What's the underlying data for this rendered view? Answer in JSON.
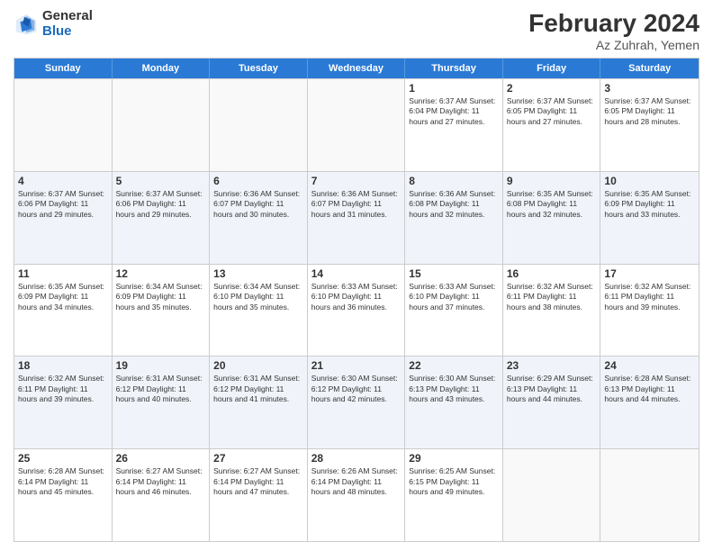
{
  "logo": {
    "general": "General",
    "blue": "Blue"
  },
  "title": "February 2024",
  "subtitle": "Az Zuhrah, Yemen",
  "days_of_week": [
    "Sunday",
    "Monday",
    "Tuesday",
    "Wednesday",
    "Thursday",
    "Friday",
    "Saturday"
  ],
  "weeks": [
    [
      {
        "day": "",
        "info": ""
      },
      {
        "day": "",
        "info": ""
      },
      {
        "day": "",
        "info": ""
      },
      {
        "day": "",
        "info": ""
      },
      {
        "day": "1",
        "info": "Sunrise: 6:37 AM\nSunset: 6:04 PM\nDaylight: 11 hours\nand 27 minutes."
      },
      {
        "day": "2",
        "info": "Sunrise: 6:37 AM\nSunset: 6:05 PM\nDaylight: 11 hours\nand 27 minutes."
      },
      {
        "day": "3",
        "info": "Sunrise: 6:37 AM\nSunset: 6:05 PM\nDaylight: 11 hours\nand 28 minutes."
      }
    ],
    [
      {
        "day": "4",
        "info": "Sunrise: 6:37 AM\nSunset: 6:06 PM\nDaylight: 11 hours\nand 29 minutes."
      },
      {
        "day": "5",
        "info": "Sunrise: 6:37 AM\nSunset: 6:06 PM\nDaylight: 11 hours\nand 29 minutes."
      },
      {
        "day": "6",
        "info": "Sunrise: 6:36 AM\nSunset: 6:07 PM\nDaylight: 11 hours\nand 30 minutes."
      },
      {
        "day": "7",
        "info": "Sunrise: 6:36 AM\nSunset: 6:07 PM\nDaylight: 11 hours\nand 31 minutes."
      },
      {
        "day": "8",
        "info": "Sunrise: 6:36 AM\nSunset: 6:08 PM\nDaylight: 11 hours\nand 32 minutes."
      },
      {
        "day": "9",
        "info": "Sunrise: 6:35 AM\nSunset: 6:08 PM\nDaylight: 11 hours\nand 32 minutes."
      },
      {
        "day": "10",
        "info": "Sunrise: 6:35 AM\nSunset: 6:09 PM\nDaylight: 11 hours\nand 33 minutes."
      }
    ],
    [
      {
        "day": "11",
        "info": "Sunrise: 6:35 AM\nSunset: 6:09 PM\nDaylight: 11 hours\nand 34 minutes."
      },
      {
        "day": "12",
        "info": "Sunrise: 6:34 AM\nSunset: 6:09 PM\nDaylight: 11 hours\nand 35 minutes."
      },
      {
        "day": "13",
        "info": "Sunrise: 6:34 AM\nSunset: 6:10 PM\nDaylight: 11 hours\nand 35 minutes."
      },
      {
        "day": "14",
        "info": "Sunrise: 6:33 AM\nSunset: 6:10 PM\nDaylight: 11 hours\nand 36 minutes."
      },
      {
        "day": "15",
        "info": "Sunrise: 6:33 AM\nSunset: 6:10 PM\nDaylight: 11 hours\nand 37 minutes."
      },
      {
        "day": "16",
        "info": "Sunrise: 6:32 AM\nSunset: 6:11 PM\nDaylight: 11 hours\nand 38 minutes."
      },
      {
        "day": "17",
        "info": "Sunrise: 6:32 AM\nSunset: 6:11 PM\nDaylight: 11 hours\nand 39 minutes."
      }
    ],
    [
      {
        "day": "18",
        "info": "Sunrise: 6:32 AM\nSunset: 6:11 PM\nDaylight: 11 hours\nand 39 minutes."
      },
      {
        "day": "19",
        "info": "Sunrise: 6:31 AM\nSunset: 6:12 PM\nDaylight: 11 hours\nand 40 minutes."
      },
      {
        "day": "20",
        "info": "Sunrise: 6:31 AM\nSunset: 6:12 PM\nDaylight: 11 hours\nand 41 minutes."
      },
      {
        "day": "21",
        "info": "Sunrise: 6:30 AM\nSunset: 6:12 PM\nDaylight: 11 hours\nand 42 minutes."
      },
      {
        "day": "22",
        "info": "Sunrise: 6:30 AM\nSunset: 6:13 PM\nDaylight: 11 hours\nand 43 minutes."
      },
      {
        "day": "23",
        "info": "Sunrise: 6:29 AM\nSunset: 6:13 PM\nDaylight: 11 hours\nand 44 minutes."
      },
      {
        "day": "24",
        "info": "Sunrise: 6:28 AM\nSunset: 6:13 PM\nDaylight: 11 hours\nand 44 minutes."
      }
    ],
    [
      {
        "day": "25",
        "info": "Sunrise: 6:28 AM\nSunset: 6:14 PM\nDaylight: 11 hours\nand 45 minutes."
      },
      {
        "day": "26",
        "info": "Sunrise: 6:27 AM\nSunset: 6:14 PM\nDaylight: 11 hours\nand 46 minutes."
      },
      {
        "day": "27",
        "info": "Sunrise: 6:27 AM\nSunset: 6:14 PM\nDaylight: 11 hours\nand 47 minutes."
      },
      {
        "day": "28",
        "info": "Sunrise: 6:26 AM\nSunset: 6:14 PM\nDaylight: 11 hours\nand 48 minutes."
      },
      {
        "day": "29",
        "info": "Sunrise: 6:25 AM\nSunset: 6:15 PM\nDaylight: 11 hours\nand 49 minutes."
      },
      {
        "day": "",
        "info": ""
      },
      {
        "day": "",
        "info": ""
      }
    ]
  ]
}
